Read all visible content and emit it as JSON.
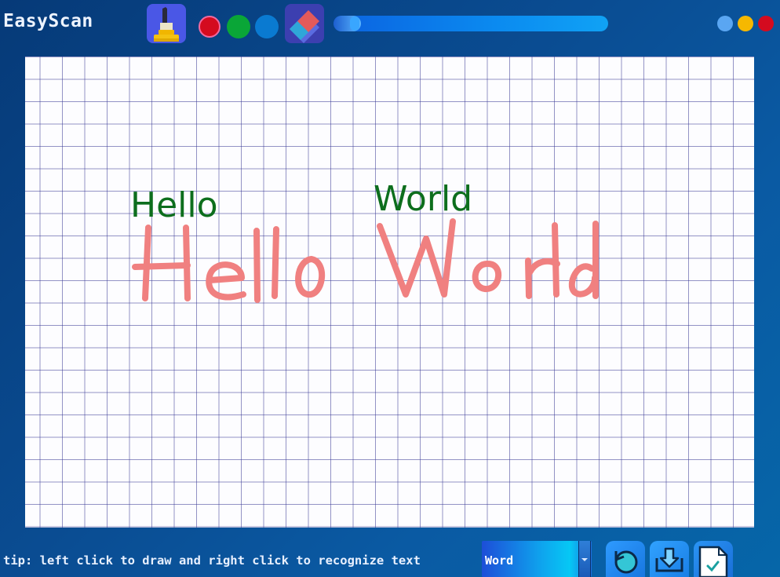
{
  "app": {
    "title": "EasyScan"
  },
  "toolbar": {
    "tools": [
      {
        "name": "pen",
        "icon": "marker-pen-icon"
      },
      {
        "name": "eraser",
        "icon": "eraser-icon"
      }
    ],
    "colors": [
      "#d40b1f",
      "#0aa637",
      "#0a7ad1"
    ],
    "selected_color": "#d40b1f",
    "progress": 0.1
  },
  "window_controls": [
    "#5aa6f2",
    "#f6b800",
    "#d40b1f"
  ],
  "canvas": {
    "recognized_words": [
      "Hello",
      "World"
    ],
    "handwritten_words": [
      "Hello",
      "World"
    ],
    "ink_color": "#f08080",
    "recognized_color": "#0d6e1d"
  },
  "footer": {
    "tip": "tip: left click to draw and right click to recognize text",
    "mode_value": "Word",
    "buttons": [
      {
        "name": "reset",
        "icon": "refresh-icon"
      },
      {
        "name": "save",
        "icon": "download-icon"
      },
      {
        "name": "recognize",
        "icon": "document-check-icon"
      }
    ]
  }
}
